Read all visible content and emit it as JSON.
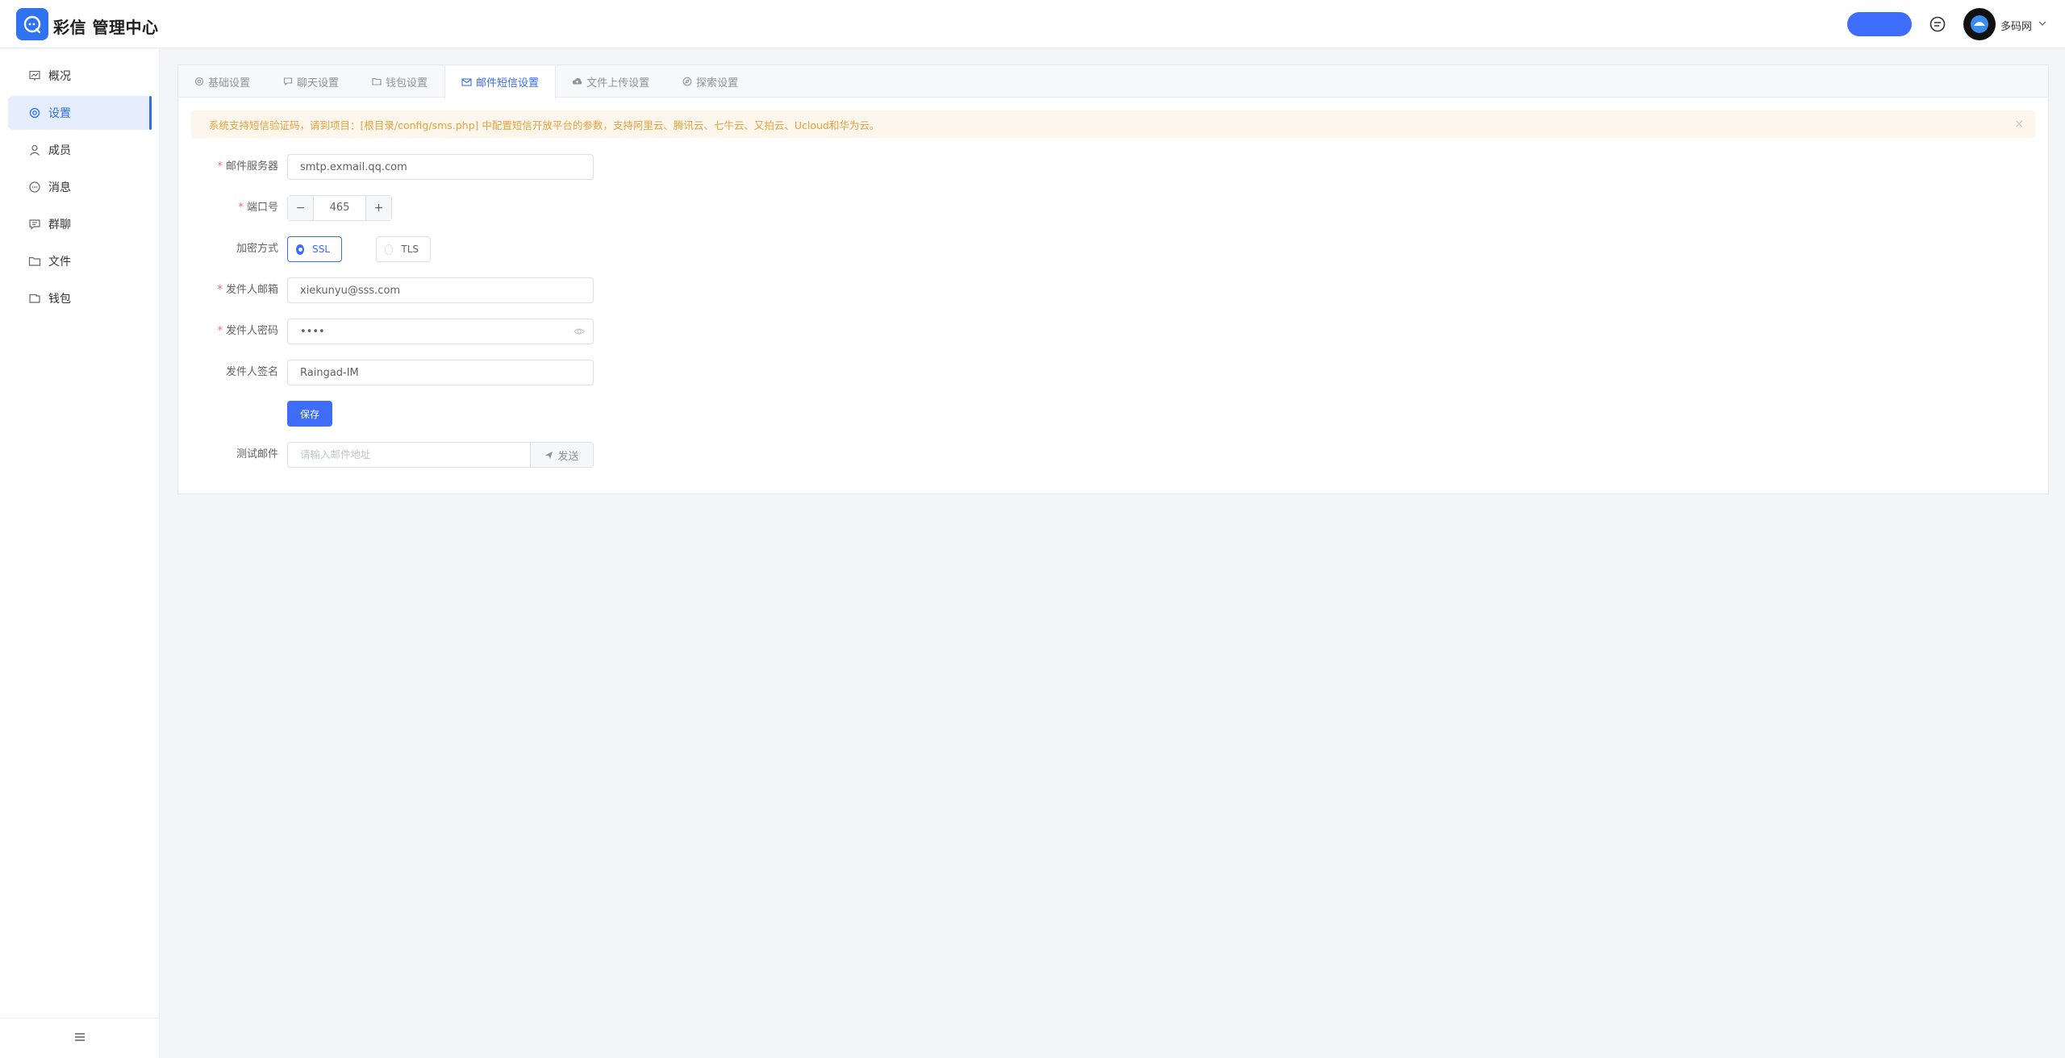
{
  "header": {
    "title": "彩信 管理中心",
    "username": "多码网",
    "logo_icon": "chat-logo-icon",
    "message_icon": "message-icon"
  },
  "sidebar": {
    "items": [
      {
        "label": "概况",
        "icon": "dashboard-icon",
        "active": false
      },
      {
        "label": "设置",
        "icon": "gear-icon",
        "active": true
      },
      {
        "label": "成员",
        "icon": "user-icon",
        "active": false
      },
      {
        "label": "消息",
        "icon": "chat-icon",
        "active": false
      },
      {
        "label": "群聊",
        "icon": "group-chat-icon",
        "active": false
      },
      {
        "label": "文件",
        "icon": "folder-icon",
        "active": false
      },
      {
        "label": "钱包",
        "icon": "wallet-icon",
        "active": false
      }
    ],
    "collapse_icon": "menu-icon"
  },
  "tabs": [
    {
      "label": "基础设置",
      "icon": "gear-icon",
      "active": false
    },
    {
      "label": "聊天设置",
      "icon": "chat-icon",
      "active": false
    },
    {
      "label": "钱包设置",
      "icon": "folder-icon",
      "active": false
    },
    {
      "label": "邮件短信设置",
      "icon": "mail-icon",
      "active": true
    },
    {
      "label": "文件上传设置",
      "icon": "cloud-upload-icon",
      "active": false
    },
    {
      "label": "探索设置",
      "icon": "compass-icon",
      "active": false
    }
  ],
  "alert": {
    "text": "系统支持短信验证码，请到项目：[根目录/config/sms.php] 中配置短信开放平台的参数，支持阿里云、腾讯云、七牛云、又拍云、Ucloud和华为云。",
    "close": "×"
  },
  "form": {
    "smtp_label": "邮件服务器",
    "smtp_value": "smtp.exmail.qq.com",
    "port_label": "端口号",
    "port_value": "465",
    "port_minus": "−",
    "port_plus": "+",
    "encrypt_label": "加密方式",
    "encrypt_options": [
      "SSL",
      "TLS"
    ],
    "encrypt_selected": "SSL",
    "sender_email_label": "发件人邮箱",
    "sender_email_value": "xiekunyu@sss.com",
    "sender_pwd_label": "发件人密码",
    "sender_pwd_value": "••••",
    "sender_sign_label": "发件人签名",
    "sender_sign_value": "Raingad-IM",
    "save_label": "保存",
    "test_label": "测试邮件",
    "test_placeholder": "请输入邮件地址",
    "send_label": "发送"
  },
  "colors": {
    "accent": "#3d6dfa",
    "warning": "#e6a23c",
    "required": "#f56c6c"
  }
}
